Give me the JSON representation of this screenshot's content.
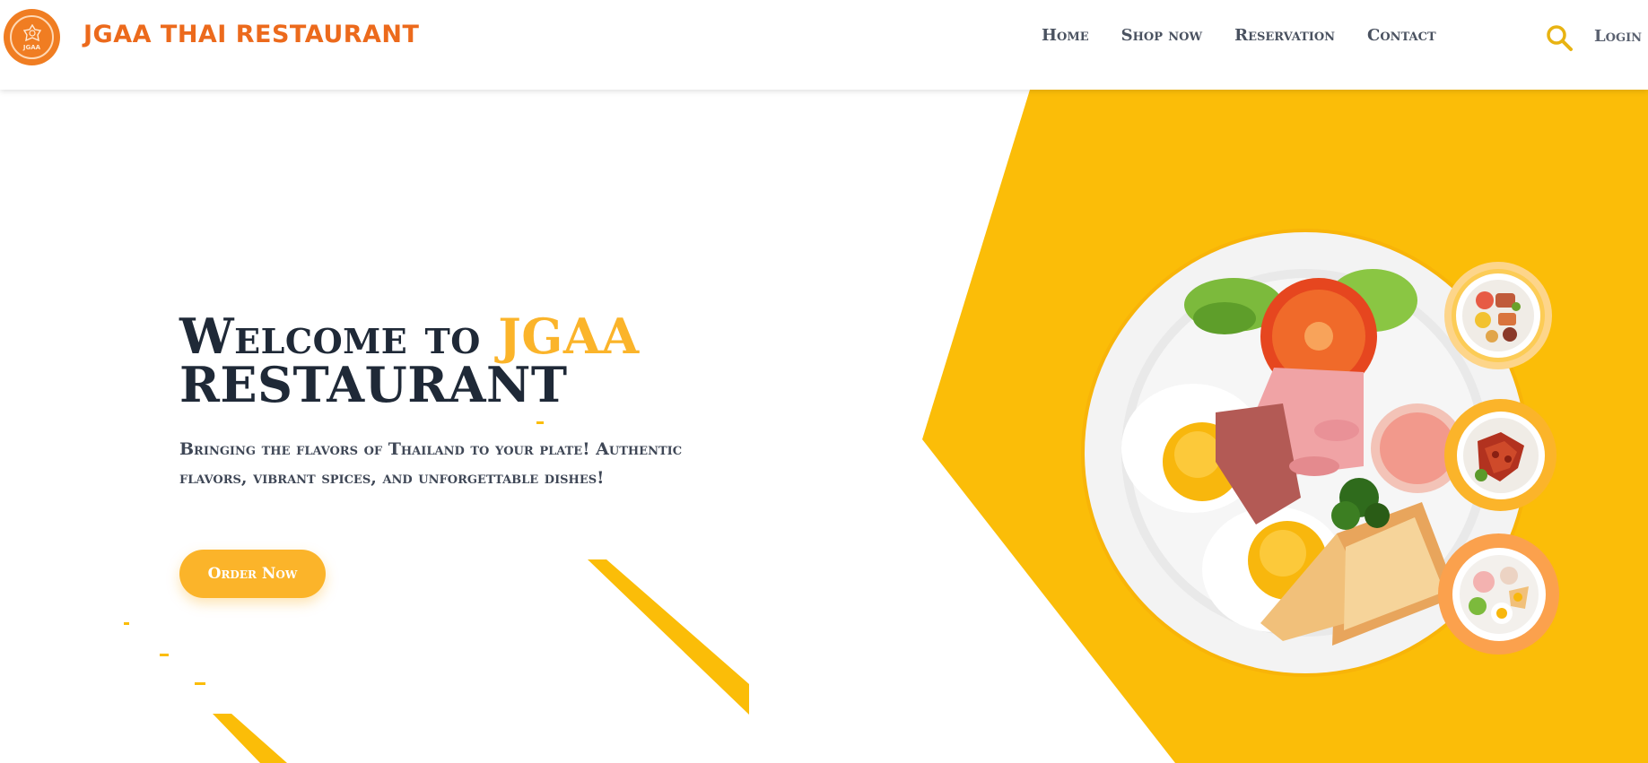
{
  "nav": {
    "logo_text": "JGAA",
    "brand": "JGAA THAI RESTAURANT",
    "links": [
      "Home",
      "Shop now",
      "Reservation",
      "Contact"
    ],
    "search_icon": "search-icon",
    "login": "Login"
  },
  "hero": {
    "title_part1": "Welcome to ",
    "title_accent": "JGAA",
    "title_part2": "RESTAURANT",
    "subtitle": "Bringing the flavors of Thailand to your plate! Authentic flavors, vibrant spices, and unforgettable dishes!",
    "cta": "Order Now"
  },
  "images": {
    "main_plate": "breakfast-plate-image",
    "thumbnails": [
      "thai-platter-thumbnail",
      "spicy-wings-thumbnail",
      "breakfast-plate-thumbnail"
    ]
  },
  "colors": {
    "brand_orange": "#ec6a1c",
    "accent_yellow": "#fbb42a",
    "hero_bg_yellow": "#fbbd08",
    "text_dark": "#1f2937",
    "nav_text": "#4a5260"
  }
}
